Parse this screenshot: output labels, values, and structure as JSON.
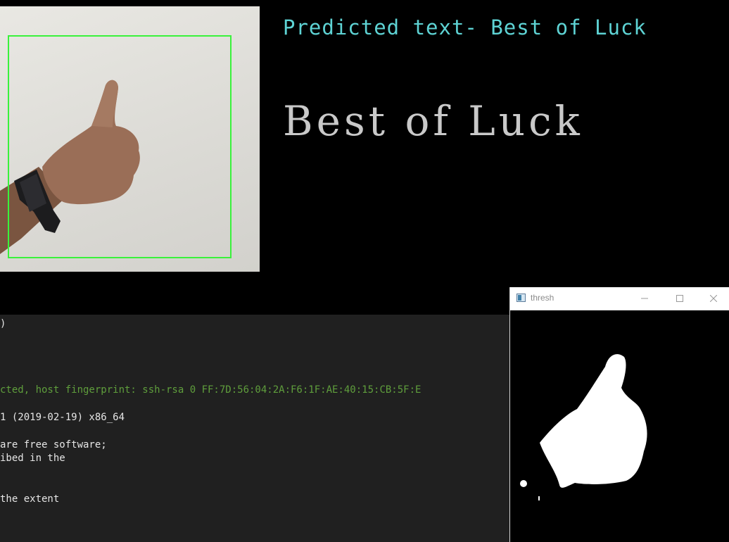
{
  "prediction": {
    "label": "Predicted text- Best of Luck",
    "large_text": "Best of Luck",
    "label_color": "#5ed3d4",
    "large_text_color": "#c9c9c9"
  },
  "camera": {
    "roi_box_color": "#39f23b"
  },
  "terminal": {
    "lines": [
      ")",
      "cted, host fingerprint: ssh-rsa 0 FF:7D:56:04:2A:F6:1F:AE:40:15:CB:5F:E",
      "1 (2019-02-19) x86_64",
      "are free software;",
      "ibed in the",
      "the extent"
    ]
  },
  "thresh_window": {
    "title": "thresh",
    "icons": {
      "app": "opencv-window-icon",
      "minimize": "minimize-icon",
      "maximize": "maximize-icon",
      "close": "close-icon"
    }
  }
}
